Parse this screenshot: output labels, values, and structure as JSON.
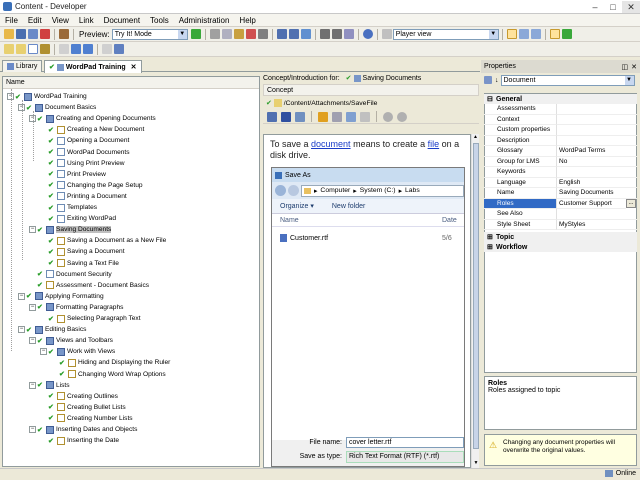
{
  "window": {
    "title": "Content - Developer"
  },
  "menu": [
    "File",
    "Edit",
    "View",
    "Link",
    "Document",
    "Tools",
    "Administration",
    "Help"
  ],
  "toolbar": {
    "preview_label": "Preview:",
    "preview_mode": "Try It! Mode",
    "player_view": "Player view"
  },
  "tabs": [
    {
      "label": "Library"
    },
    {
      "label": "WordPad Training"
    }
  ],
  "tree": {
    "header": "Name",
    "items": [
      {
        "label": "WordPad Training",
        "level": 0,
        "icon": "book",
        "exp": true
      },
      {
        "label": "Document Basics",
        "level": 1,
        "icon": "book",
        "exp": true
      },
      {
        "label": "Creating and Opening Documents",
        "level": 2,
        "icon": "book",
        "exp": true
      },
      {
        "label": "Creating a New Document",
        "level": 3,
        "icon": "q"
      },
      {
        "label": "Opening a Document",
        "level": 3,
        "icon": "doc"
      },
      {
        "label": "WordPad Documents",
        "level": 3,
        "icon": "doc"
      },
      {
        "label": "Using Print Preview",
        "level": 3,
        "icon": "doc"
      },
      {
        "label": "Print Preview",
        "level": 3,
        "icon": "doc"
      },
      {
        "label": "Changing the Page Setup",
        "level": 3,
        "icon": "doc"
      },
      {
        "label": "Printing a Document",
        "level": 3,
        "icon": "doc"
      },
      {
        "label": "Templates",
        "level": 3,
        "icon": "doc"
      },
      {
        "label": "Exiting WordPad",
        "level": 3,
        "icon": "doc"
      },
      {
        "label": "Saving Documents",
        "level": 2,
        "icon": "book",
        "exp": true,
        "selected": true
      },
      {
        "label": "Saving a Document as a New File",
        "level": 3,
        "icon": "q"
      },
      {
        "label": "Saving a Document",
        "level": 3,
        "icon": "q"
      },
      {
        "label": "Saving a Text File",
        "level": 3,
        "icon": "q"
      },
      {
        "label": "Document Security",
        "level": 2,
        "icon": "doc"
      },
      {
        "label": "Assessment - Document Basics",
        "level": 2,
        "icon": "q"
      },
      {
        "label": "Applying Formatting",
        "level": 1,
        "icon": "book",
        "exp": true
      },
      {
        "label": "Formatting Paragraphs",
        "level": 2,
        "icon": "book",
        "exp": true
      },
      {
        "label": "Selecting Paragraph Text",
        "level": 3,
        "icon": "q"
      },
      {
        "label": "Editing Basics",
        "level": 1,
        "icon": "book",
        "exp": true
      },
      {
        "label": "Views and Toolbars",
        "level": 2,
        "icon": "book",
        "exp": true
      },
      {
        "label": "Work with Views",
        "level": 3,
        "icon": "book",
        "exp": true
      },
      {
        "label": "Hiding and Displaying the Ruler",
        "level": 4,
        "icon": "q"
      },
      {
        "label": "Changing Word Wrap Options",
        "level": 4,
        "icon": "q"
      },
      {
        "label": "Lists",
        "level": 2,
        "icon": "book",
        "exp": true
      },
      {
        "label": "Creating Outlines",
        "level": 3,
        "icon": "q"
      },
      {
        "label": "Creating Bullet Lists",
        "level": 3,
        "icon": "q"
      },
      {
        "label": "Creating Number Lists",
        "level": 3,
        "icon": "q"
      },
      {
        "label": "Inserting Dates and Objects",
        "level": 2,
        "icon": "book",
        "exp": true
      },
      {
        "label": "Inserting the Date",
        "level": 3,
        "icon": "q"
      }
    ]
  },
  "concept": {
    "intro_label": "Concept/Introduction for:",
    "intro_value": "Saving Documents",
    "section": "Concept",
    "path": "/Content/Attachments/SaveFile",
    "text_before": "To save a ",
    "link1": "document",
    "text_mid": " means to create a ",
    "link2": "file",
    "text_after": " on a disk drive.",
    "dialog": {
      "title": "Save As",
      "address": [
        "Computer",
        "System (C:)",
        "Labs"
      ],
      "organize": "Organize",
      "new_folder": "New folder",
      "col_name": "Name",
      "col_date": "Date",
      "file": "Customer.rtf",
      "file_date": "5/6",
      "file_name_label": "File name:",
      "file_name_value": "cover letter.rtf",
      "save_type_label": "Save as type:",
      "save_type_value": "Rich Text Format (RTF) (*.rtf)"
    }
  },
  "properties": {
    "title": "Properties",
    "object": "Document",
    "general": "General",
    "rows": [
      {
        "k": "Assessments",
        "v": ""
      },
      {
        "k": "Context",
        "v": ""
      },
      {
        "k": "Custom properties",
        "v": ""
      },
      {
        "k": "Description",
        "v": ""
      },
      {
        "k": "Glossary",
        "v": "WordPad Terms"
      },
      {
        "k": "Group for LMS",
        "v": "No"
      },
      {
        "k": "Keywords",
        "v": ""
      },
      {
        "k": "Language",
        "v": "English"
      },
      {
        "k": "Name",
        "v": "Saving Documents"
      },
      {
        "k": "Roles",
        "v": "Customer Support"
      },
      {
        "k": "See Also",
        "v": ""
      },
      {
        "k": "Style Sheet",
        "v": "MyStyles"
      }
    ],
    "topic": "Topic",
    "workflow": "Workflow",
    "desc_title": "Roles",
    "desc_text": "Roles assigned to topic",
    "warning": "Changing any document properties will overwrite the original values."
  },
  "status": {
    "online": "Online"
  }
}
